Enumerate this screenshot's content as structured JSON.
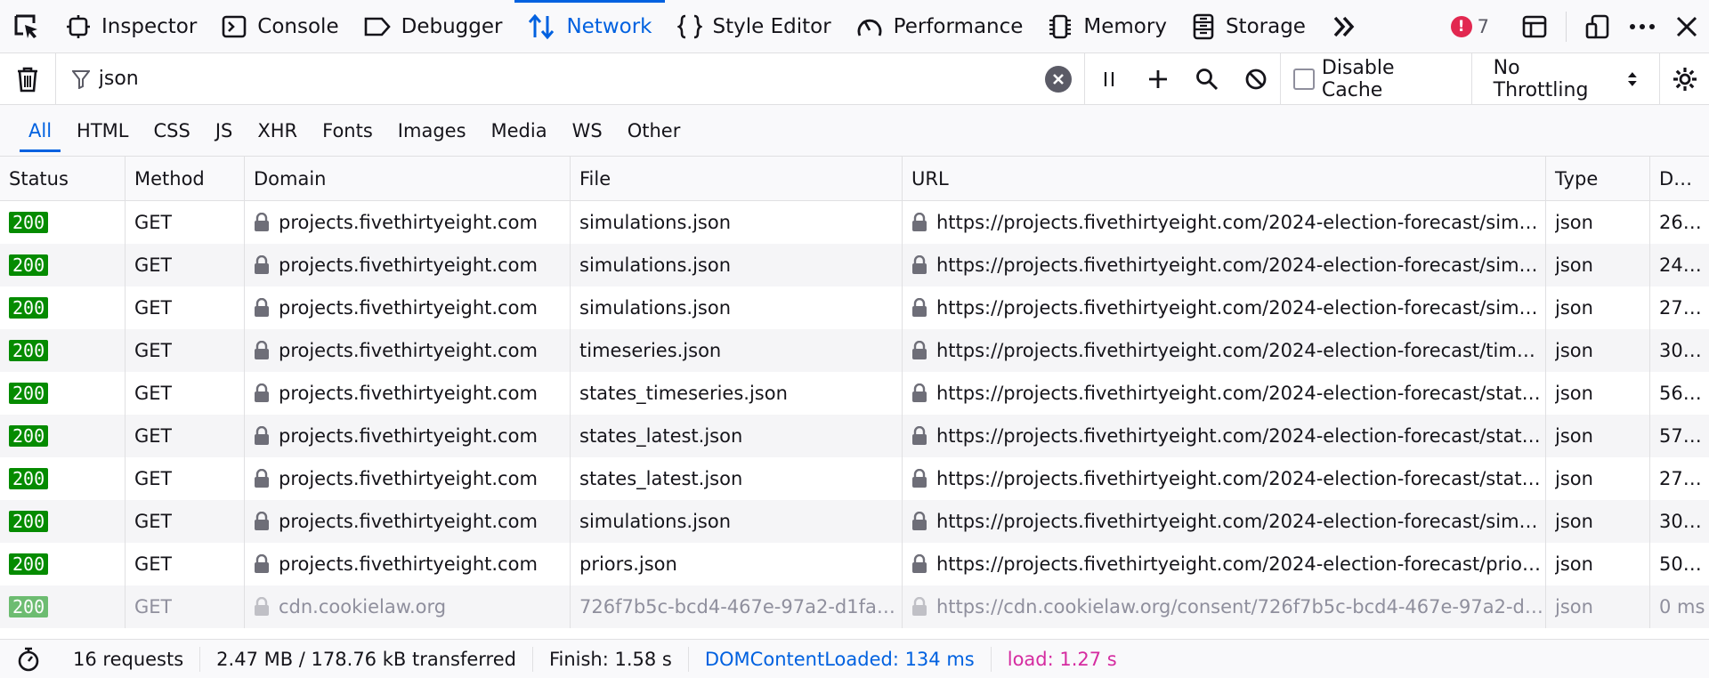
{
  "toolbar": {
    "tabs": [
      {
        "label": "Inspector",
        "icon": "inspector-icon"
      },
      {
        "label": "Console",
        "icon": "console-icon"
      },
      {
        "label": "Debugger",
        "icon": "debugger-icon"
      },
      {
        "label": "Network",
        "icon": "network-icon",
        "active": true
      },
      {
        "label": "Style Editor",
        "icon": "style-editor-icon"
      },
      {
        "label": "Performance",
        "icon": "performance-icon"
      },
      {
        "label": "Memory",
        "icon": "memory-icon"
      },
      {
        "label": "Storage",
        "icon": "storage-icon"
      }
    ],
    "error_count": "7",
    "accent": "#0061e0",
    "error_color": "#e22850"
  },
  "filter": {
    "value": "json",
    "disable_cache_label": "Disable Cache",
    "throttling_label": "No Throttling"
  },
  "type_filters": [
    "All",
    "HTML",
    "CSS",
    "JS",
    "XHR",
    "Fonts",
    "Images",
    "Media",
    "WS",
    "Other"
  ],
  "table": {
    "columns": [
      "Status",
      "Method",
      "Domain",
      "File",
      "URL",
      "Type",
      "D…"
    ],
    "rows": [
      {
        "status": "200",
        "method": "GET",
        "domain": "projects.fivethirtyeight.com",
        "file": "simulations.json",
        "url": "https://projects.fivethirtyeight.com/2024-election-forecast/simul…",
        "type": "json",
        "duration": "26…"
      },
      {
        "status": "200",
        "method": "GET",
        "domain": "projects.fivethirtyeight.com",
        "file": "simulations.json",
        "url": "https://projects.fivethirtyeight.com/2024-election-forecast/simul…",
        "type": "json",
        "duration": "24…"
      },
      {
        "status": "200",
        "method": "GET",
        "domain": "projects.fivethirtyeight.com",
        "file": "simulations.json",
        "url": "https://projects.fivethirtyeight.com/2024-election-forecast/simul…",
        "type": "json",
        "duration": "27…"
      },
      {
        "status": "200",
        "method": "GET",
        "domain": "projects.fivethirtyeight.com",
        "file": "timeseries.json",
        "url": "https://projects.fivethirtyeight.com/2024-election-forecast/times…",
        "type": "json",
        "duration": "30…"
      },
      {
        "status": "200",
        "method": "GET",
        "domain": "projects.fivethirtyeight.com",
        "file": "states_timeseries.json",
        "url": "https://projects.fivethirtyeight.com/2024-election-forecast/states…",
        "type": "json",
        "duration": "56…"
      },
      {
        "status": "200",
        "method": "GET",
        "domain": "projects.fivethirtyeight.com",
        "file": "states_latest.json",
        "url": "https://projects.fivethirtyeight.com/2024-election-forecast/states…",
        "type": "json",
        "duration": "57…"
      },
      {
        "status": "200",
        "method": "GET",
        "domain": "projects.fivethirtyeight.com",
        "file": "states_latest.json",
        "url": "https://projects.fivethirtyeight.com/2024-election-forecast/states…",
        "type": "json",
        "duration": "27…"
      },
      {
        "status": "200",
        "method": "GET",
        "domain": "projects.fivethirtyeight.com",
        "file": "simulations.json",
        "url": "https://projects.fivethirtyeight.com/2024-election-forecast/simul…",
        "type": "json",
        "duration": "30…"
      },
      {
        "status": "200",
        "method": "GET",
        "domain": "projects.fivethirtyeight.com",
        "file": "priors.json",
        "url": "https://projects.fivethirtyeight.com/2024-election-forecast/priors.…",
        "type": "json",
        "duration": "50…"
      },
      {
        "status": "200",
        "method": "GET",
        "domain": "cdn.cookielaw.org",
        "file": "726f7b5c-bcd4-467e-97a2-d1fafd6a6",
        "url": "https://cdn.cookielaw.org/consent/726f7b5c-bcd4-467e-97a2-d1f…",
        "type": "json",
        "duration": "0 ms",
        "faded": true
      }
    ]
  },
  "statusbar": {
    "requests": "16 requests",
    "transferred": "2.47 MB / 178.76 kB transferred",
    "finish": "Finish: 1.58 s",
    "dom_content_loaded": "DOMContentLoaded: 134 ms",
    "load": "load: 1.27 s"
  }
}
